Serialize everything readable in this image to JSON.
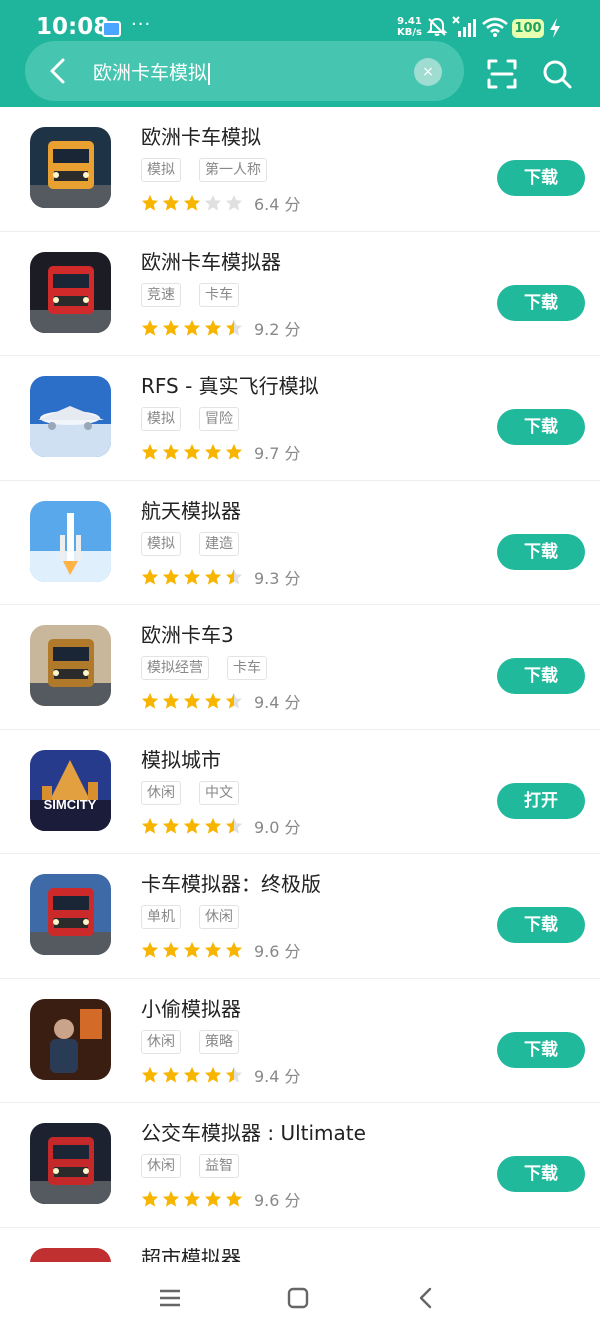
{
  "status": {
    "time": "10:08",
    "dots": "···",
    "speed_value": "9.41",
    "speed_unit": "KB/s",
    "battery": "100"
  },
  "search": {
    "query": "欧洲卡车模拟",
    "clear_symbol": "×"
  },
  "apps": [
    {
      "name": "欧洲卡车模拟",
      "tags": [
        "模拟",
        "第一人称"
      ],
      "stars": 3,
      "score": "6.4 分",
      "button": "下载",
      "icon": "truck-orange-icon",
      "colors": [
        "#1f3347",
        "#e8a030"
      ]
    },
    {
      "name": "欧洲卡车模拟器",
      "tags": [
        "竞速",
        "卡车"
      ],
      "stars": 4.5,
      "score": "9.2 分",
      "button": "下载",
      "icon": "truck-black-red-icon",
      "colors": [
        "#1c1c24",
        "#d02a2a"
      ]
    },
    {
      "name": "RFS - 真实飞行模拟",
      "tags": [
        "模拟",
        "冒险"
      ],
      "stars": 5,
      "score": "9.7 分",
      "button": "下载",
      "icon": "airplane-icon",
      "colors": [
        "#2c6fc8",
        "#cfe0f2"
      ]
    },
    {
      "name": "航天模拟器",
      "tags": [
        "模拟",
        "建造"
      ],
      "stars": 4.5,
      "score": "9.3 分",
      "button": "下载",
      "icon": "rocket-icon",
      "colors": [
        "#5aa8ec",
        "#dfeffc"
      ]
    },
    {
      "name": "欧洲卡车3",
      "tags": [
        "模拟经营",
        "卡车"
      ],
      "stars": 4.5,
      "score": "9.4 分",
      "button": "下载",
      "icon": "truck-gold-icon",
      "colors": [
        "#c9b79c",
        "#b07a2a"
      ]
    },
    {
      "name": "模拟城市",
      "tags": [
        "休闲",
        "中文"
      ],
      "stars": 4.5,
      "score": "9.0 分",
      "button": "打开",
      "icon": "simcity-icon",
      "icon_text": "SIMCITY",
      "colors": [
        "#263b8c",
        "#e3a040"
      ]
    },
    {
      "name": "卡车模拟器：终极版",
      "tags": [
        "单机",
        "休闲"
      ],
      "stars": 5,
      "score": "9.6 分",
      "button": "下载",
      "icon": "truck-red-icon",
      "colors": [
        "#3f6aa8",
        "#cc2a2a"
      ]
    },
    {
      "name": "小偷模拟器",
      "tags": [
        "休闲",
        "策略"
      ],
      "stars": 4.5,
      "score": "9.4 分",
      "button": "下载",
      "icon": "thief-icon",
      "colors": [
        "#3a1e12",
        "#d46a28"
      ]
    },
    {
      "name": "公交车模拟器 : Ultimate",
      "tags": [
        "休闲",
        "益智"
      ],
      "stars": 5,
      "score": "9.6 分",
      "button": "下载",
      "icon": "bus-red-icon",
      "colors": [
        "#1d2230",
        "#c42828"
      ]
    },
    {
      "name": "超市模拟器",
      "tags": [],
      "stars": 0,
      "score": "",
      "button": "",
      "icon": "supermarket-icon",
      "colors": [
        "#d8d8d8",
        "#c03030"
      ]
    }
  ],
  "theme": {
    "accent": "#1fb59c",
    "button": "#20b99c",
    "star_on": "#f7b500",
    "star_off": "#e0e0e0"
  }
}
